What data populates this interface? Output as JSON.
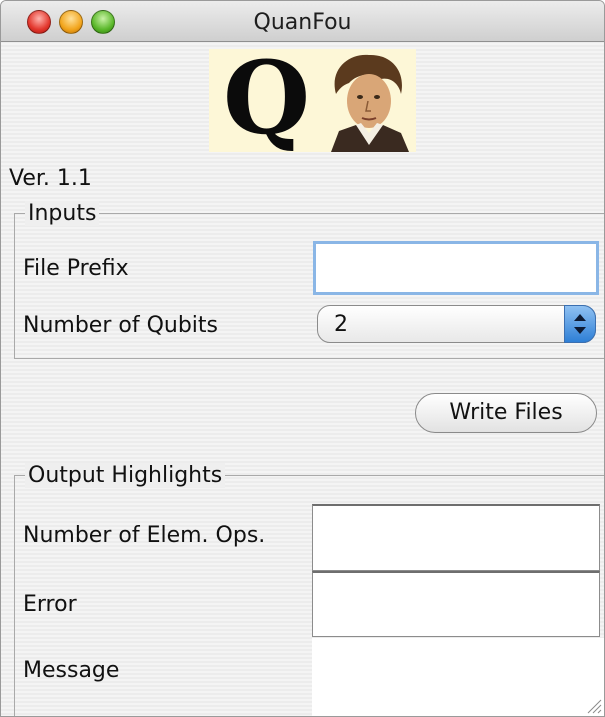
{
  "window": {
    "title": "QuanFou"
  },
  "header": {
    "version": "Ver. 1.1",
    "logo_letter": "Q"
  },
  "inputs": {
    "legend": "Inputs",
    "file_prefix_label": "File Prefix",
    "file_prefix_value": "",
    "qubits_label": "Number of Qubits",
    "qubits_value": "2"
  },
  "actions": {
    "write_label": "Write Files"
  },
  "outputs": {
    "legend": "Output Highlights",
    "elem_ops_label": "Number of Elem. Ops.",
    "elem_ops_value": "",
    "error_label": "Error",
    "error_value": "",
    "message_label": "Message",
    "message_value": ""
  },
  "colors": {
    "focus_ring": "#8ab6e6",
    "stepper_blue": "#2e7fd6",
    "logo_bg": "#fdf7d7"
  }
}
